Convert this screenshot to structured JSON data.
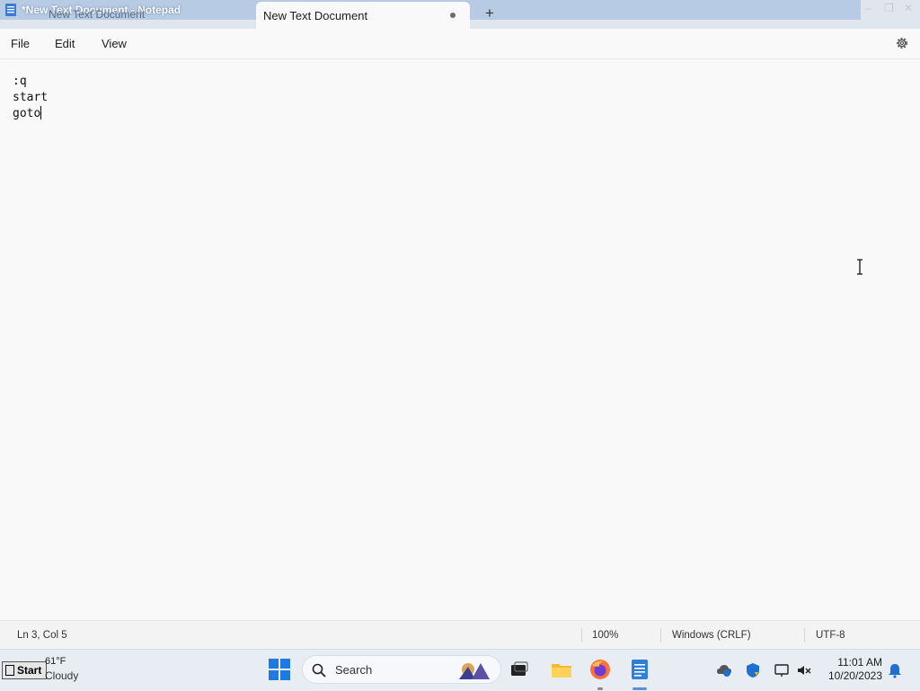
{
  "window": {
    "title": "*New Text Document - Notepad",
    "inactive_tab": "New Text Document",
    "active_tab": "New Text Document",
    "new_tab": "+",
    "controls": {
      "minimize": "–",
      "maximize": "❐",
      "close": "✕"
    }
  },
  "menu": {
    "file": "File",
    "edit": "Edit",
    "view": "View"
  },
  "editor": {
    "lines": [
      ":q",
      "start",
      "goto"
    ]
  },
  "status": {
    "position": "Ln 3, Col 5",
    "zoom": "100%",
    "line_ending": "Windows (CRLF)",
    "encoding": "UTF-8"
  },
  "taskbar": {
    "start_label": "Start",
    "weather_temp": "61°F",
    "weather_cond": "Cloudy",
    "search_label": "Search",
    "time": "11:01 AM",
    "date": "10/20/2023"
  },
  "colors": {
    "accent": "#0067c0",
    "taskbar": "#e8edf4",
    "titlebar_highlight": "#b7cbe4"
  }
}
